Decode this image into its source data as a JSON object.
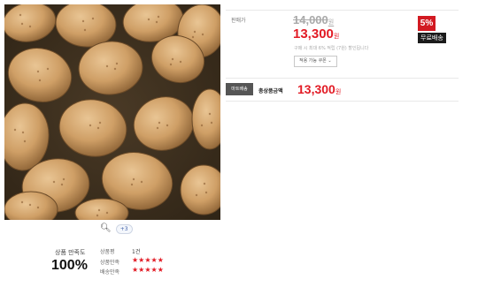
{
  "product": {
    "image_alt": "potatoes",
    "zoom_icon": "magnifier-icon",
    "image_count": "+3"
  },
  "satisfaction": {
    "label": "상품 만족도",
    "percent": "100%",
    "rows": [
      {
        "label": "상품평",
        "value": "1건"
      },
      {
        "label": "상품만족",
        "stars": "★★★★★"
      },
      {
        "label": "배송만족",
        "stars": "★★★★★"
      }
    ]
  },
  "pricing": {
    "label": "판매가",
    "original_price": "14,000",
    "sale_price": "13,300",
    "currency": "원",
    "note": "구매 시 최대 6% 적립 (7원) 할인됩니다",
    "option_select": "적용 가능 쿠폰 ⌄",
    "discount_badge": "5%",
    "free_shipping": "무료배송"
  },
  "order": {
    "quantity_label": "마트배송",
    "total_label": "총상품금액",
    "total_value": "13,300",
    "currency": "원"
  },
  "colors": {
    "accent_red": "#e21b25",
    "badge_dark": "#1b1b1b"
  }
}
